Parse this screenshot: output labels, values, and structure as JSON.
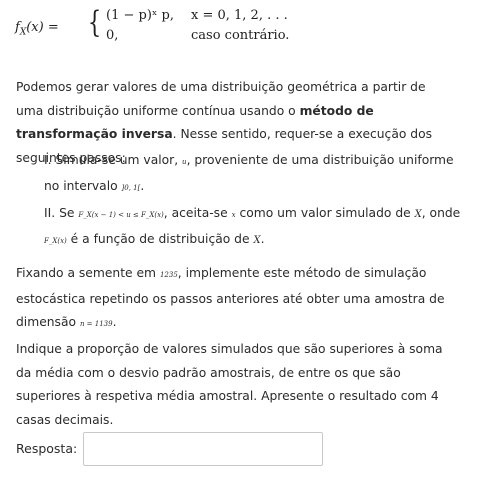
{
  "formula": {
    "lhs": "f",
    "lhs_sub": "X",
    "lhs_arg": "(x) =",
    "brace": "{",
    "case1_expr": "(1 − p)ˣ p,",
    "case1_cond": "x = 0, 1, 2, . . .",
    "case2_expr": "0,",
    "case2_cond": "caso contrário."
  },
  "intro": {
    "t1": "Podemos gerar valores de uma distribuição geométrica a partir de uma distribuição uniforme contínua usando o ",
    "bold": "método de transformação inversa",
    "t2": ". Nesse sentido, requer-se a execução dos seguintes passos:"
  },
  "steps": [
    {
      "num": "I.",
      "t1": "Simula-se um valor, ",
      "m1": "u",
      "t2": ", proveniente de uma distribuição uniforme no intervalo ",
      "m2": "]0, 1[",
      "t3": "."
    },
    {
      "num": "II.",
      "t1": "Se ",
      "m1": "F_X(x − 1) < u ≤ F_X(x)",
      "t2": ", aceita-se ",
      "m2": "x",
      "t3": " como um valor simulado de ",
      "m3": "X",
      "t4": ", onde ",
      "m4": "F_X(x)",
      "t5": " é a função de distribuição de ",
      "m5": "X",
      "t6": "."
    }
  ],
  "para2": {
    "t1": "Fixando a semente em ",
    "m1": "1235",
    "t2": ", implemente este método de simulação estocástica repetindo os passos anteriores até obter uma amostra de dimensão ",
    "m2": "n = 1139",
    "t3": "."
  },
  "para3": "Indique a proporção de valores simulados que são superiores à soma da média com o desvio padrão amostrais, de entre os que são superiores à respetiva média amostral. Apresente o resultado com 4 casas decimais.",
  "answer": {
    "label": "Resposta:",
    "value": ""
  }
}
